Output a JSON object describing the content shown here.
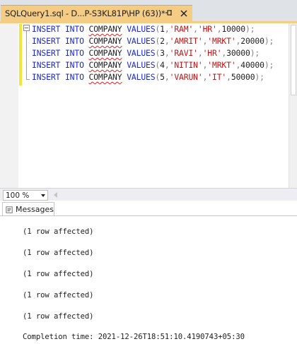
{
  "tab": {
    "title": "SQLQuery1.sql - D...P-S3KL81P\\HP (63))*",
    "pin_icon": "pin-icon",
    "close_icon": "close-icon"
  },
  "editor": {
    "lines": [
      {
        "kw": "INSERT INTO",
        "table": "COMPANY",
        "kw2": "VALUES",
        "id": "1",
        "name": "'RAM'",
        "dept": "'HR'",
        "salary": "10000"
      },
      {
        "kw": "INSERT INTO",
        "table": "COMPANY",
        "kw2": "VALUES",
        "id": "2",
        "name": "'AMRIT'",
        "dept": "'MRKT'",
        "salary": "20000"
      },
      {
        "kw": "INSERT INTO",
        "table": "COMPANY",
        "kw2": "VALUES",
        "id": "3",
        "name": "'RAVI'",
        "dept": "'HR'",
        "salary": "30000"
      },
      {
        "kw": "INSERT INTO",
        "table": "COMPANY",
        "kw2": "VALUES",
        "id": "4",
        "name": "'NITIN'",
        "dept": "'MRKT'",
        "salary": "40000"
      },
      {
        "kw": "INSERT INTO",
        "table": "COMPANY",
        "kw2": "VALUES",
        "id": "5",
        "name": "'VARUN'",
        "dept": "'IT'",
        "salary": "50000"
      }
    ],
    "colors": {
      "keyword": "#1a28d4",
      "string": "#c21414",
      "punctuation": "#808080",
      "changebar": "#f3e53a"
    }
  },
  "zoom": {
    "value": "100 %"
  },
  "results": {
    "tab_label": "Messages",
    "messages": [
      "(1 row affected)",
      "(1 row affected)",
      "(1 row affected)",
      "(1 row affected)",
      "(1 row affected)",
      "Completion time: 2021-12-26T18:51:10.4190743+05:30"
    ]
  },
  "accent_color": "#f5cc84"
}
